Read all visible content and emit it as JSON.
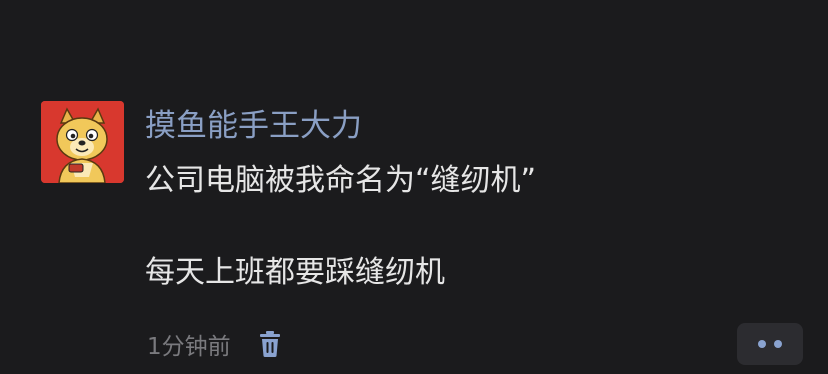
{
  "post": {
    "author": "摸鱼能手王大力",
    "content_lines": [
      "公司电脑被我命名为“缝纫机”",
      "",
      "每天上班都要踩缝纫机"
    ],
    "timestamp": "1分钟前",
    "avatar_icon": "doge-avatar-icon",
    "delete_icon": "trash-icon",
    "more_icon": "more-dots-icon"
  },
  "colors": {
    "background": "#1b1b1d",
    "author_name": "#8a9fc4",
    "content_text": "#e6e6e6",
    "meta_text": "#7a7a7e",
    "avatar_bg": "#d8382e",
    "more_button_bg": "#2c2c30"
  }
}
